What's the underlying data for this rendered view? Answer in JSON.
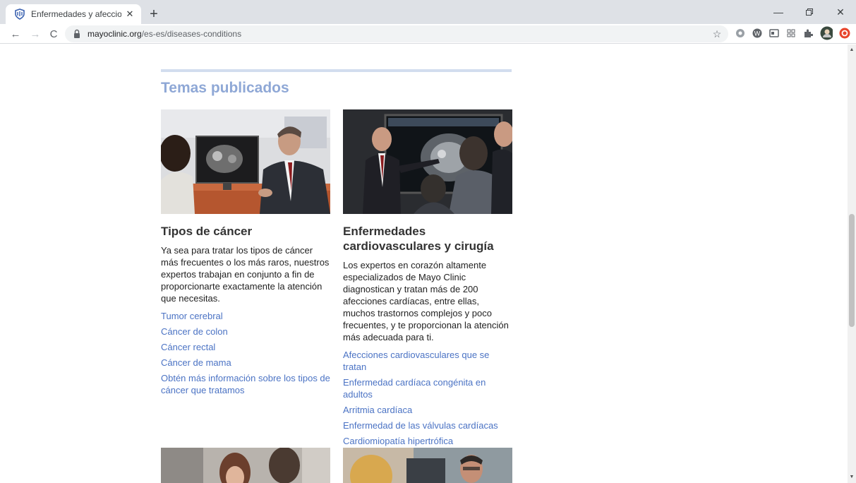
{
  "browser": {
    "tab_title": "Enfermedades y afecciones - Ma",
    "new_tab_label": "+",
    "url_domain": "mayoclinic.org",
    "url_path": "/es-es/diseases-conditions",
    "icons": [
      "back-icon",
      "forward-icon",
      "reload-icon",
      "lock-icon",
      "star-icon",
      "minimize-icon",
      "restore-icon",
      "close-icon",
      "extensions-icon",
      "profile-icon"
    ]
  },
  "page": {
    "section_title": "Temas publicados",
    "accent_color": "#8fa8d6",
    "link_color": "#4b73c4",
    "cards": [
      {
        "title": "Tipos de cáncer",
        "description": "Ya sea para tratar los tipos de cáncer más frecuentes o los más raros, nuestros expertos trabajan en conjunto a fin de proporcionarte exactamente la atención que necesitas.",
        "links": [
          "Tumor cerebral",
          "Cáncer de colon",
          "Cáncer rectal",
          "Cáncer de mama",
          "Obtén más información sobre los tipos de cáncer que tratamos"
        ]
      },
      {
        "title": "Enfermedades cardiovasculares y cirugía",
        "description": "Los expertos en corazón altamente especializados de Mayo Clinic diagnostican y tratan más de 200 afecciones cardíacas, entre ellas, muchos trastornos complejos y poco frecuentes, y te proporcionan la atención más adecuada para ti.",
        "links": [
          "Afecciones cardiovasculares que se tratan",
          "Enfermedad cardíaca congénita en adultos",
          "Arritmia cardíaca",
          "Enfermedad de las válvulas cardíacas",
          "Cardiomiopatía hipertrófica"
        ]
      }
    ]
  }
}
